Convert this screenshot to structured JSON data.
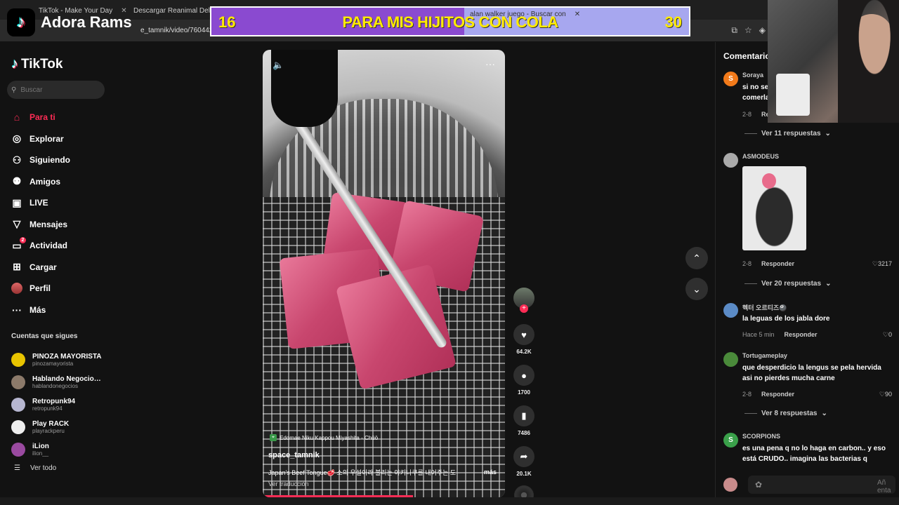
{
  "overlay": {
    "brand_name": "Adora Rams",
    "goal": {
      "left_count": "16",
      "text": "PARA MIS HIJITOS CON COLA",
      "right_count": "30",
      "progress_fraction": 0.53
    }
  },
  "browser": {
    "tabs": [
      {
        "label": "TikTok - Make Your Day"
      },
      {
        "label": "Descargar Reanimal Delux"
      },
      {
        "label": "alan walker juego - Buscar con"
      }
    ],
    "url": "e_tamnik/video/760442"
  },
  "tiktok": {
    "logo_text": "TikTok",
    "search_placeholder": "Buscar",
    "nav": [
      {
        "label": "Para ti",
        "icon": "home-icon",
        "active": true
      },
      {
        "label": "Explorar",
        "icon": "compass-icon"
      },
      {
        "label": "Siguiendo",
        "icon": "following-icon"
      },
      {
        "label": "Amigos",
        "icon": "friends-icon"
      },
      {
        "label": "LIVE",
        "icon": "live-icon"
      },
      {
        "label": "Mensajes",
        "icon": "messages-icon"
      },
      {
        "label": "Actividad",
        "icon": "activity-icon",
        "badge": "2"
      },
      {
        "label": "Cargar",
        "icon": "upload-icon"
      },
      {
        "label": "Perfil",
        "icon": "profile-avatar"
      },
      {
        "label": "Más",
        "icon": "more-icon"
      }
    ],
    "following_title": "Cuentas que sigues",
    "following": [
      {
        "name": "PINOZA MAYORISTA",
        "handle": "pinozamayorista"
      },
      {
        "name": "Hablando Negocios...",
        "handle": "hablandonegocios"
      },
      {
        "name": "Retropunk94",
        "handle": "retropunk94"
      },
      {
        "name": "Play RACK",
        "handle": "playrackperu"
      },
      {
        "name": "iLion",
        "handle": "ilion__"
      }
    ],
    "see_all": "Ver todo"
  },
  "video": {
    "music": "Edomae Niku Kappou Miyashita - Chūō",
    "author": "space_tamnik",
    "description": "Japan's Beef Tongue🥩 소의 우설이라 불리는 야키니쿠를 내어주는 도",
    "more": "más",
    "translate": "Ver traducción",
    "progress_fraction": 0.62
  },
  "actions": {
    "likes": "64.2K",
    "comments": "1700",
    "saves": "7486",
    "shares": "20.1K"
  },
  "comments": {
    "title": "Comentarios",
    "items": [
      {
        "user": "Soraya",
        "avatar": "S",
        "text": "si no se comerla",
        "date": "2-8",
        "reply": "Responder",
        "replies": "Ver 11 respuestas"
      },
      {
        "user": "ASMODEUS",
        "avatar": "",
        "text": "",
        "date": "2-8",
        "reply": "Responder",
        "likes": "3217",
        "replies": "Ver 20 respuestas"
      },
      {
        "user": "헥터 오르티즈🎱",
        "avatar": "",
        "text": "la leguas de los jabla dore",
        "date": "Hace 5 min",
        "reply": "Responder",
        "likes": "0"
      },
      {
        "user": "Tortugameplay",
        "avatar": "",
        "text": "que desperdicio la lengus se pela hervida asi no pierdes mucha carne",
        "date": "2-8",
        "reply": "Responder",
        "likes": "90",
        "replies": "Ver 8 respuestas"
      },
      {
        "user": "SCORPIONS",
        "avatar": "S",
        "text": "es una pena q no lo haga en carbon.. y eso está CRUDO.. imagina las bacterias q",
        "date": "",
        "reply": "",
        "likes": ""
      }
    ],
    "input_post": "Añ enta"
  },
  "colors": {
    "accent": "#fe2c55",
    "goal_bg": "#a7a7ef",
    "goal_fill": "#8a4ad0",
    "goal_text": "#ffea00"
  }
}
